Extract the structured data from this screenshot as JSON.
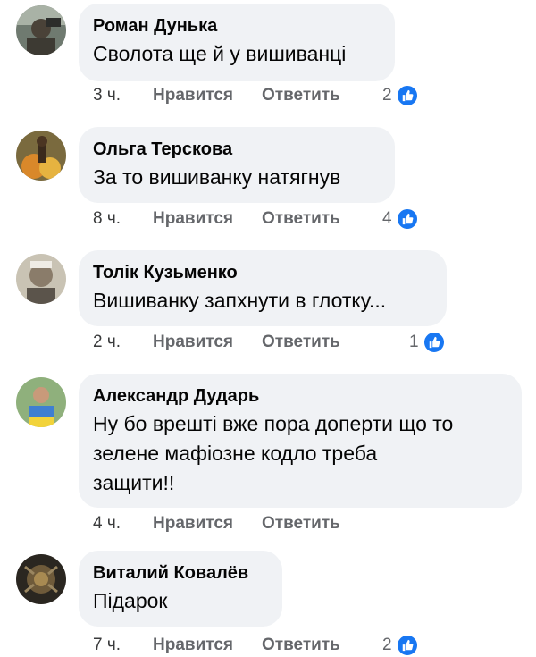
{
  "comments": [
    {
      "author": "Роман Дунька",
      "text": "Сволота ще й у вишиванці",
      "time": "3 ч.",
      "like": "Нравится",
      "reply": "Ответить",
      "reactions": "2"
    },
    {
      "author": "Ольга Терскова",
      "text": "За то вишиванку натягнув",
      "time": "8 ч.",
      "like": "Нравится",
      "reply": "Ответить",
      "reactions": "4"
    },
    {
      "author": "Толік Кузьменко",
      "text": "Вишиванку запхнути в глотку...",
      "time": "2 ч.",
      "like": "Нравится",
      "reply": "Ответить",
      "reactions": "1"
    },
    {
      "author": "Александр Дударь",
      "text_lines": [
        "Ну бо врешті вже пора доперти що то",
        "зелене мафіозне кодло треба",
        "защити!!"
      ],
      "time": "4 ч.",
      "like": "Нравится",
      "reply": "Ответить"
    },
    {
      "author": "Виталий Ковалёв",
      "text": "Підарок",
      "time": "7 ч.",
      "like": "Нравится",
      "reply": "Ответить",
      "reactions": "2"
    }
  ],
  "colors": {
    "bubble": "#f0f2f5",
    "like_blue": "#1877f2",
    "meta_gray": "#65676b"
  },
  "icons": {
    "reaction": "thumbs-up-icon"
  }
}
